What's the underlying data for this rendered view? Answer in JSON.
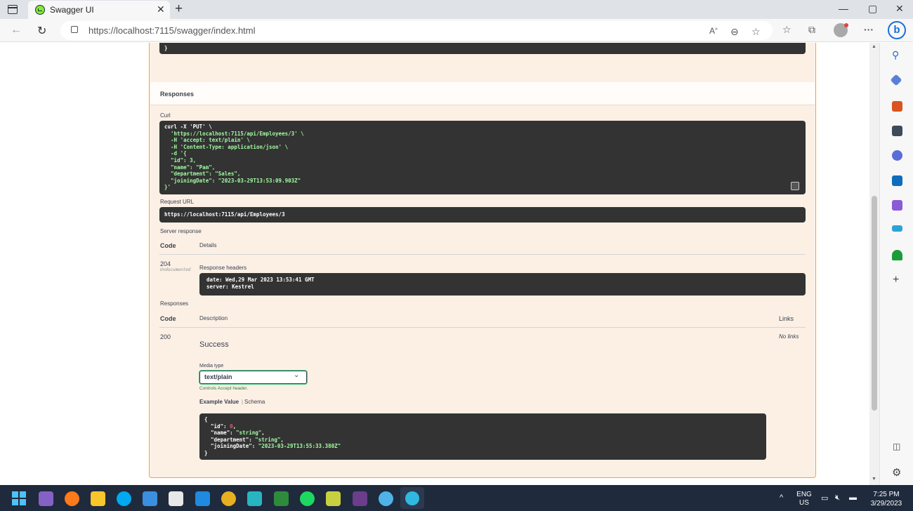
{
  "browser": {
    "tab_title": "Swagger UI",
    "tab_close": "✕",
    "new_tab": "+",
    "url": "https://localhost:7115/swagger/index.html",
    "bing_label": "b",
    "window_controls": {
      "minimize": "—",
      "maximize": "▢",
      "close": "✕"
    }
  },
  "page": {
    "top_code_tail": "}",
    "responses_header": "Responses",
    "curl_label": "Curl",
    "curl_lines": [
      "curl -X 'PUT' \\",
      "  'https://localhost:7115/api/Employees/3' \\",
      "  -H 'accept: text/plain' \\",
      "  -H 'Content-Type: application/json' \\",
      "  -d '{",
      "  \"id\": 3,",
      "  \"name\": \"Pam\",",
      "  \"department\": \"Sales\",",
      "  \"joiningDate\": \"2023-03-29T13:53:09.903Z\"",
      "}'"
    ],
    "request_url_label": "Request URL",
    "request_url": "https://localhost:7115/api/Employees/3",
    "server_response_label": "Server response",
    "col_code": "Code",
    "col_details": "Details",
    "server_code": "204",
    "server_undocumented": "Undocumented",
    "response_headers_label": "Response headers",
    "response_headers": [
      "date: Wed,29 Mar 2023 13:53:41 GMT",
      "server: Kestrel"
    ],
    "responses_label": "Responses",
    "col_description": "Description",
    "col_links": "Links",
    "resp_code": "200",
    "resp_description": "Success",
    "resp_links": "No links",
    "media_type_label": "Media type",
    "media_type_value": "text/plain",
    "controls_accept": "Controls Accept header.",
    "example_value_tab": "Example Value",
    "schema_tab": "Schema",
    "example_lines": [
      "{",
      "  \"id\": 0,",
      "  \"name\": \"string\",",
      "  \"department\": \"string\",",
      "  \"joiningDate\": \"2023-03-29T13:55:33.380Z\"",
      "}"
    ]
  },
  "taskbar": {
    "lang_line1": "ENG",
    "lang_line2": "US",
    "time": "7:25 PM",
    "date": "3/29/2023",
    "chevron": "^"
  },
  "colors": {
    "put_accent": "#fca130",
    "put_bg": "#fcf0e5",
    "code_bg": "#333333",
    "string_green": "#a2fca2",
    "number_red": "#d36363",
    "select_border": "#41444e"
  }
}
